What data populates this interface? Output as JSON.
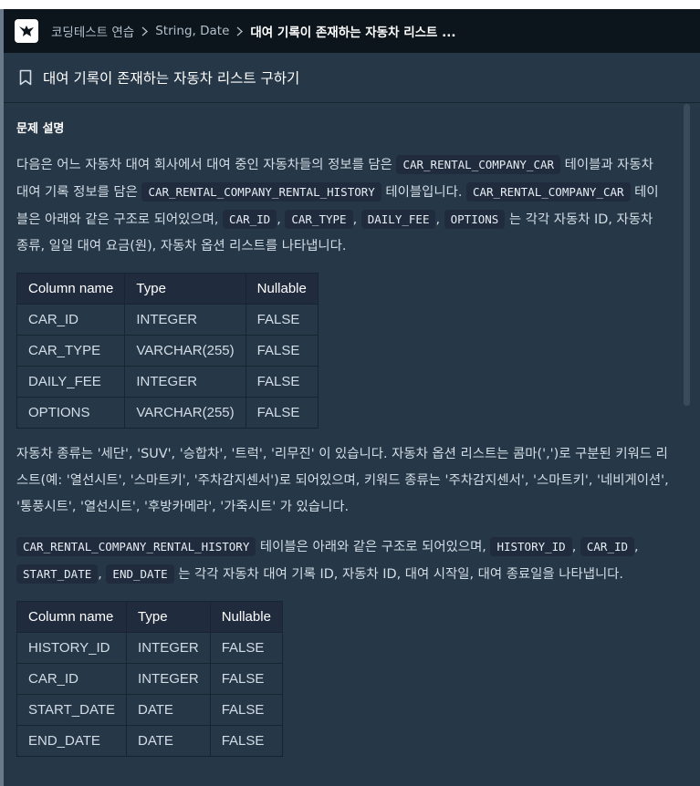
{
  "header": {
    "logo_icon": "programmers-bird-icon",
    "breadcrumb": [
      "코딩테스트 연습",
      "String, Date",
      "대여 기록이 존재하는 자동차 리스트 ..."
    ]
  },
  "problem": {
    "bookmark_icon": "bookmark-icon",
    "title": "대여 기록이 존재하는 자동차 리스트 구하기"
  },
  "description": {
    "section_title": "문제 설명",
    "para1": {
      "t1": "다음은 어느 자동차 대여 회사에서 대여 중인 자동차들의 정보를 담은 ",
      "c1": "CAR_RENTAL_COMPANY_CAR",
      "t2": " 테이블과 자동차 대여 기록 정보를 담은 ",
      "c2": "CAR_RENTAL_COMPANY_RENTAL_HISTORY",
      "t3": " 테이블입니다. ",
      "c3": "CAR_RENTAL_COMPANY_CAR",
      "t4": " 테이블은 아래와 같은 구조로 되어있으며, ",
      "c4": "CAR_ID",
      "t5": ", ",
      "c5": "CAR_TYPE",
      "t6": ", ",
      "c6": "DAILY_FEE",
      "t7": ", ",
      "c7": "OPTIONS",
      "t8": " 는 각각 자동차 ID, 자동차 종류, 일일 대여 요금(원), 자동차 옵션 리스트를 나타냅니다."
    },
    "table1": {
      "headers": [
        "Column name",
        "Type",
        "Nullable"
      ],
      "rows": [
        [
          "CAR_ID",
          "INTEGER",
          "FALSE"
        ],
        [
          "CAR_TYPE",
          "VARCHAR(255)",
          "FALSE"
        ],
        [
          "DAILY_FEE",
          "INTEGER",
          "FALSE"
        ],
        [
          "OPTIONS",
          "VARCHAR(255)",
          "FALSE"
        ]
      ]
    },
    "para2": "자동차 종류는 '세단', 'SUV', '승합차', '트럭', '리무진' 이 있습니다. 자동차 옵션 리스트는 콤마(',')로 구분된 키워드 리스트(예: '열선시트', '스마트키', '주차감지센서')로 되어있으며, 키워드 종류는 '주차감지센서', '스마트키', '네비게이션', '통풍시트', '열선시트', '후방카메라', '가죽시트' 가 있습니다.",
    "para3": {
      "c1": "CAR_RENTAL_COMPANY_RENTAL_HISTORY",
      "t1": " 테이블은 아래와 같은 구조로 되어있으며, ",
      "c2": "HISTORY_ID",
      "t2": ", ",
      "c3": "CAR_ID",
      "t3": ", ",
      "c4": "START_DATE",
      "t4": ", ",
      "c5": "END_DATE",
      "t5": " 는 각각 자동차 대여 기록 ID, 자동차 ID, 대여 시작일, 대여 종료일을 나타냅니다."
    },
    "table2": {
      "headers": [
        "Column name",
        "Type",
        "Nullable"
      ],
      "rows": [
        [
          "HISTORY_ID",
          "INTEGER",
          "FALSE"
        ],
        [
          "CAR_ID",
          "INTEGER",
          "FALSE"
        ],
        [
          "START_DATE",
          "DATE",
          "FALSE"
        ],
        [
          "END_DATE",
          "DATE",
          "FALSE"
        ]
      ]
    }
  },
  "colors": {
    "header_bg": "#0c151c",
    "panel_bg": "#263747",
    "code_bg": "#202b3d",
    "border": "#172530"
  }
}
